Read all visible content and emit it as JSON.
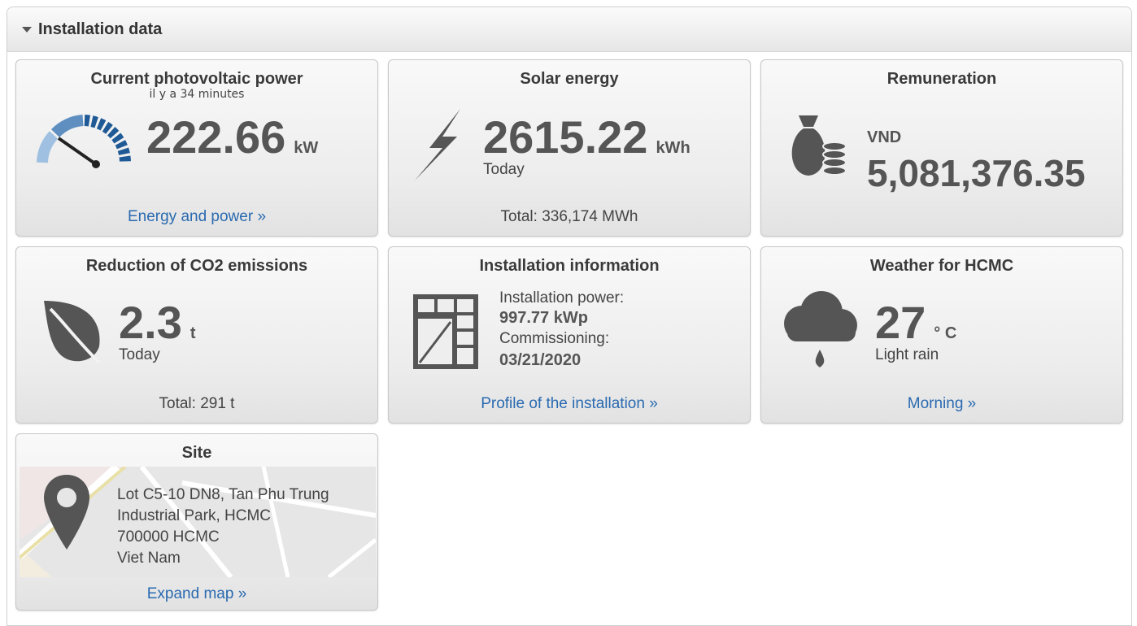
{
  "header": {
    "title": "Installation data"
  },
  "tiles": {
    "pv_power": {
      "title": "Current photovoltaic power",
      "subtitle": "il y a 34 minutes",
      "value": "222.66",
      "unit": "kW",
      "link": "Energy and power »",
      "icon": "gauge-icon"
    },
    "solar_energy": {
      "title": "Solar energy",
      "value": "2615.22",
      "unit": "kWh",
      "period": "Today",
      "total": "Total:  336,174 MWh",
      "icon": "lightning-icon"
    },
    "remuneration": {
      "title": "Remuneration",
      "currency": "VND",
      "value": "5,081,376.35",
      "icon": "money-bag-icon"
    },
    "co2": {
      "title": "Reduction of CO2 emissions",
      "value": "2.3",
      "unit": "t",
      "period": "Today",
      "total": "Total:  291 t",
      "icon": "leaf-icon"
    },
    "installation": {
      "title": "Installation information",
      "power_label": "Installation power:",
      "power_value": "997.77 kWp",
      "commissioning_label": "Commissioning:",
      "commissioning_value": "03/21/2020",
      "link": "Profile of the installation »",
      "icon": "solar-panel-icon"
    },
    "weather": {
      "title": "Weather for HCMC",
      "value": "27",
      "unit": "° C",
      "condition": "Light rain",
      "link": "Morning »",
      "icon": "rain-cloud-icon"
    },
    "site": {
      "title": "Site",
      "address_line1": "Lot C5-10 DN8, Tan Phu Trung",
      "address_line2": "Industrial Park, HCMC",
      "address_line3": "700000 HCMC",
      "address_line4": "Viet Nam",
      "link": "Expand map »",
      "icon": "map-pin-icon"
    }
  },
  "colors": {
    "link": "#2a6ab0",
    "icon": "#555555",
    "gauge_blue": "#1f5a96"
  }
}
